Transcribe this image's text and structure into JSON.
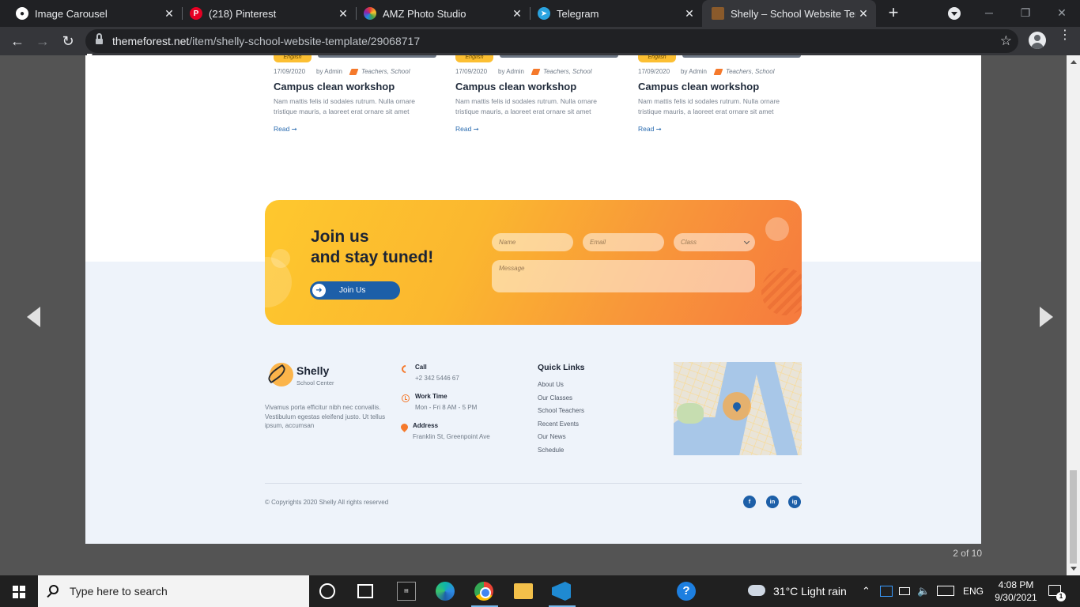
{
  "browser": {
    "tabs": [
      {
        "title": "Image Carousel",
        "icon": "github-icon",
        "active": false
      },
      {
        "title": "(218) Pinterest",
        "icon": "pinterest-icon",
        "active": false
      },
      {
        "title": "AMZ Photo Studio",
        "icon": "photo-studio-icon",
        "active": false
      },
      {
        "title": "Telegram",
        "icon": "telegram-icon",
        "active": false
      },
      {
        "title": "Shelly – School Website Temp",
        "icon": "themeforest-icon",
        "active": true
      }
    ],
    "new_tab_label": "+",
    "url_domain": "themeforest.net",
    "url_path": "/item/shelly-school-website-template/29068717"
  },
  "lightbox": {
    "counter": "2 of 10"
  },
  "preview": {
    "posts": [
      {
        "chip": "English",
        "date": "17/09/2020",
        "author": "by Admin",
        "tags": "Teachers, School",
        "title": "Campus clean workshop",
        "excerpt": "Nam mattis felis id sodales rutrum. Nulla ornare tristique mauris, a laoreet erat ornare sit amet",
        "read": "Read ➞"
      },
      {
        "chip": "English",
        "date": "17/09/2020",
        "author": "by Admin",
        "tags": "Teachers, School",
        "title": "Campus clean workshop",
        "excerpt": "Nam mattis felis id sodales rutrum. Nulla ornare tristique mauris, a laoreet erat ornare sit amet",
        "read": "Read ➞"
      },
      {
        "chip": "English",
        "date": "17/09/2020",
        "author": "by Admin",
        "tags": "Teachers, School",
        "title": "Campus clean workshop",
        "excerpt": "Nam mattis felis id sodales rutrum. Nulla ornare tristique mauris, a laoreet erat ornare sit amet",
        "read": "Read ➞"
      }
    ],
    "newsletter": {
      "heading_line1": "Join us",
      "heading_line2": "and stay tuned!",
      "button_label": "Join Us",
      "name_placeholder": "Name",
      "email_placeholder": "Email",
      "class_placeholder": "Class",
      "message_placeholder": "Message"
    },
    "footer": {
      "brand": "Shelly",
      "brand_sub": "School Center",
      "about": "Vivamus porta efficitur nibh nec convallis. Vestibulum egestas eleifend justo. Ut tellus ipsum, accumsan",
      "call_label": "Call",
      "call_value": "+2 342 5446 67",
      "work_label": "Work Time",
      "work_value": "Mon - Fri 8 AM - 5 PM",
      "address_label": "Address",
      "address_value": "Franklin St, Greenpoint Ave",
      "quick_links_title": "Quick Links",
      "quick_links": [
        "About Us",
        "Our Classes",
        "School Teachers",
        "Recent Events",
        "Our News",
        "Schedule"
      ],
      "copyright": "© Copyrights 2020 Shelly All rights reserved",
      "social": [
        "f",
        "in",
        "ig"
      ]
    },
    "colors": {
      "accent_blue": "#1d5fa8",
      "accent_orange": "#f5792b",
      "accent_yellow": "#fcbf32"
    }
  },
  "taskbar": {
    "search_placeholder": "Type here to search",
    "weather": "31°C  Light rain",
    "language": "ENG",
    "time": "4:08 PM",
    "date": "9/30/2021",
    "notification_count": "1"
  }
}
